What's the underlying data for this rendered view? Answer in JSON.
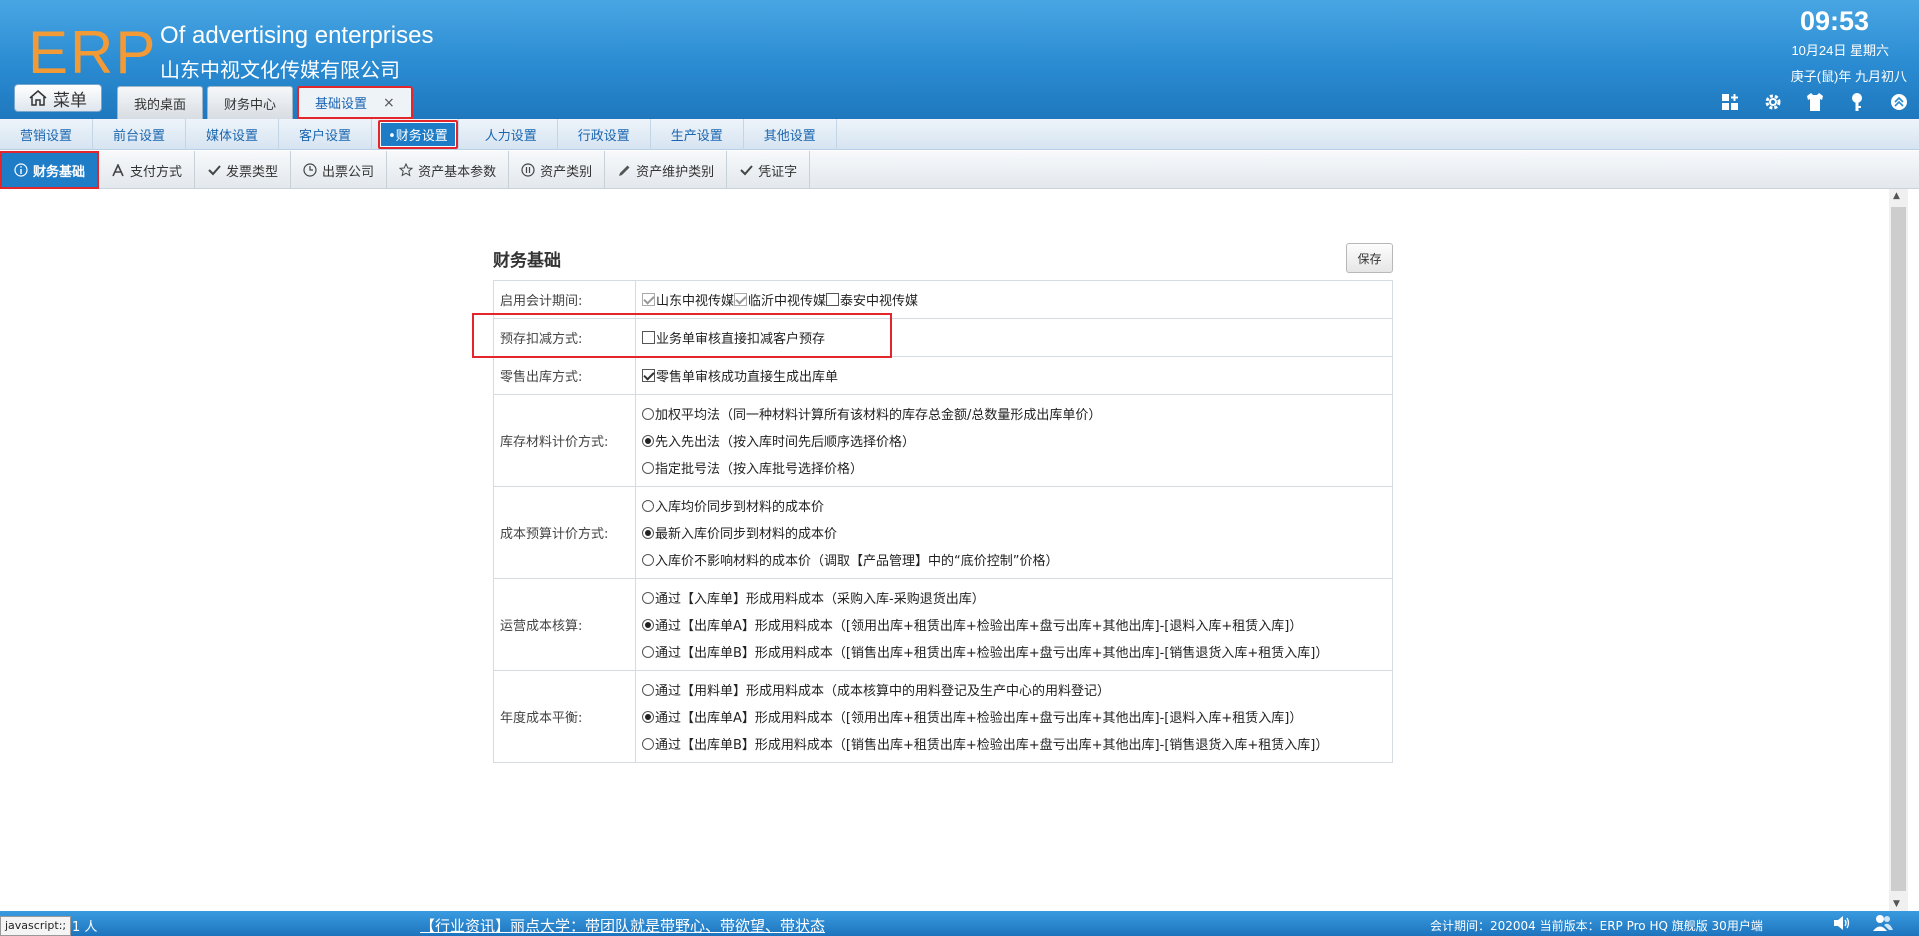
{
  "header": {
    "logo": "ERP",
    "company_en": "Of advertising enterprises",
    "company_cn": "山东中视文化传媒有限公司",
    "time": "09:53",
    "date": "10月24日 星期六",
    "lunar": "庚子(鼠)年 九月初八",
    "menu_label": "菜单",
    "tabs": [
      {
        "label": "我的桌面",
        "icon": "none"
      },
      {
        "label": "财务中心",
        "icon": "none"
      },
      {
        "label": "基础设置",
        "icon": "close-icon",
        "close": "×"
      }
    ],
    "icons": [
      "grid-add-icon",
      "gear-icon",
      "shirt-icon",
      "key-icon",
      "collapse-up-icon"
    ]
  },
  "nav2": {
    "items": [
      "营销设置",
      "前台设置",
      "媒体设置",
      "客户设置",
      "•财务设置",
      "人力设置",
      "行政设置",
      "生产设置",
      "其他设置"
    ],
    "active_index": 4
  },
  "nav3": {
    "items": [
      {
        "label": "财务基础",
        "icon": "info-circle-icon"
      },
      {
        "label": "支付方式",
        "icon": "font-a-icon"
      },
      {
        "label": "发票类型",
        "icon": "check-icon"
      },
      {
        "label": "出票公司",
        "icon": "clock-icon"
      },
      {
        "label": "资产基本参数",
        "icon": "star-icon"
      },
      {
        "label": "资产类别",
        "icon": "pause-circle-icon"
      },
      {
        "label": "资产维护类别",
        "icon": "pencil-icon"
      },
      {
        "label": "凭证字",
        "icon": "check-icon"
      }
    ],
    "active_index": 0
  },
  "form": {
    "title": "财务基础",
    "save_label": "保存",
    "rows": {
      "period": {
        "label": "启用会计期间:",
        "options": [
          {
            "text": "山东中视传媒",
            "checked": true,
            "disabled": true
          },
          {
            "text": "临沂中视传媒",
            "checked": true,
            "disabled": true
          },
          {
            "text": "泰安中视传媒",
            "checked": false,
            "disabled": false
          }
        ]
      },
      "prepay": {
        "label": "预存扣减方式:",
        "options": [
          {
            "text": "业务单审核直接扣减客户预存",
            "checked": false
          }
        ]
      },
      "retail": {
        "label": "零售出库方式:",
        "options": [
          {
            "text": "零售单审核成功直接生成出库单",
            "checked": true
          }
        ]
      },
      "stock_pricing": {
        "label": "库存材料计价方式:",
        "options": [
          {
            "text": "加权平均法（同一种材料计算所有该材料的库存总金额/总数量形成出库单价）",
            "checked": false
          },
          {
            "text": "先入先出法（按入库时间先后顺序选择价格）",
            "checked": true
          },
          {
            "text": "指定批号法（按入库批号选择价格）",
            "checked": false
          }
        ]
      },
      "budget_pricing": {
        "label": "成本预算计价方式:",
        "options": [
          {
            "text": "入库均价同步到材料的成本价",
            "checked": false
          },
          {
            "text": "最新入库价同步到材料的成本价",
            "checked": true
          },
          {
            "text": "入库价不影响材料的成本价（调取【产品管理】中的“底价控制”价格）",
            "checked": false
          }
        ]
      },
      "ops_cost": {
        "label": "运营成本核算:",
        "options": [
          {
            "text": "通过【入库单】形成用料成本（采购入库-采购退货出库）",
            "checked": false
          },
          {
            "text": "通过【出库单A】形成用料成本（[领用出库+租赁出库+检验出库+盘亏出库+其他出库]-[退料入库+租赁入库]）",
            "checked": true
          },
          {
            "text": "通过【出库单B】形成用料成本（[销售出库+租赁出库+检验出库+盘亏出库+其他出库]-[销售退货入库+租赁入库]）",
            "checked": false
          }
        ]
      },
      "annual_cost": {
        "label": "年度成本平衡:",
        "options": [
          {
            "text": "通过【用料单】形成用料成本（成本核算中的用料登记及生产中心的用料登记）",
            "checked": false
          },
          {
            "text": "通过【出库单A】形成用料成本（[领用出库+租赁出库+检验出库+盘亏出库+其他出库]-[退料入库+租赁入库]）",
            "checked": true
          },
          {
            "text": "通过【出库单B】形成用料成本（[销售出库+租赁出库+检验出库+盘亏出库+其他出库]-[销售退货入库+租赁入库]）",
            "checked": false
          }
        ]
      }
    }
  },
  "footer": {
    "status": "javascript:;",
    "users": "1 人",
    "news": "【行业资讯】丽点大学：带团队就是带野心、带欲望、带状态",
    "info": "会计期间：202004 当前版本：ERP Pro HQ 旗舰版 30用户端"
  },
  "colors": {
    "header_blue": "#2a8bd2",
    "logo_orange": "#f29a36",
    "active_blue": "#1f7dc7",
    "highlight_red": "#e2262b"
  }
}
